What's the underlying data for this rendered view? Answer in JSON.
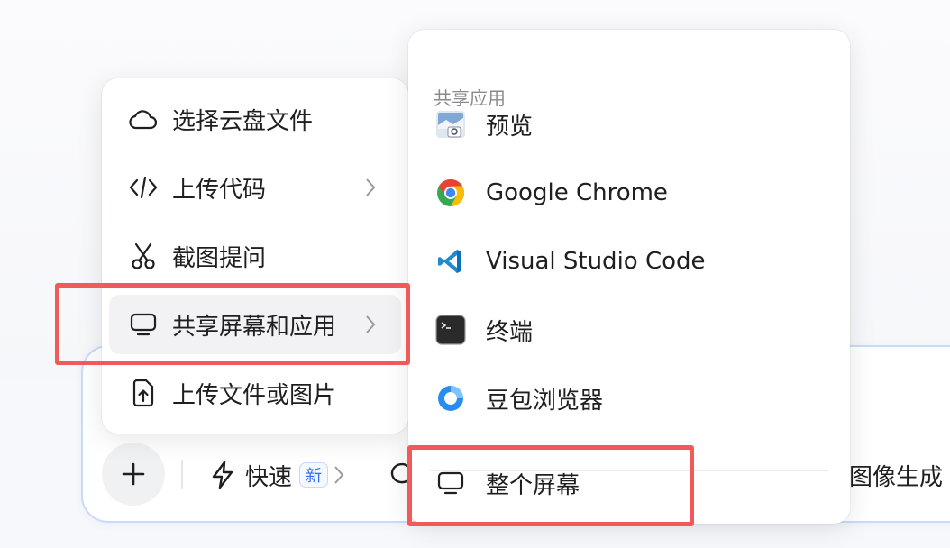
{
  "left_menu": {
    "items": [
      {
        "label": "选择云盘文件"
      },
      {
        "label": "上传代码"
      },
      {
        "label": "截图提问"
      },
      {
        "label": "共享屏幕和应用"
      },
      {
        "label": "上传文件或图片"
      }
    ]
  },
  "right_menu": {
    "section_title": "共享应用",
    "apps": [
      {
        "label": "预览"
      },
      {
        "label": "Google Chrome"
      },
      {
        "label": "Visual Studio Code"
      },
      {
        "label": "终端"
      },
      {
        "label": "豆包浏览器"
      }
    ],
    "whole_screen": "整个屏幕"
  },
  "toolbar": {
    "fast_label": "快速",
    "new_badge": "新",
    "image_gen_label": "图像生成"
  },
  "colors": {
    "highlight": "#f25a5a",
    "accent": "#2f6cf3",
    "border": "#c7dbfb"
  }
}
